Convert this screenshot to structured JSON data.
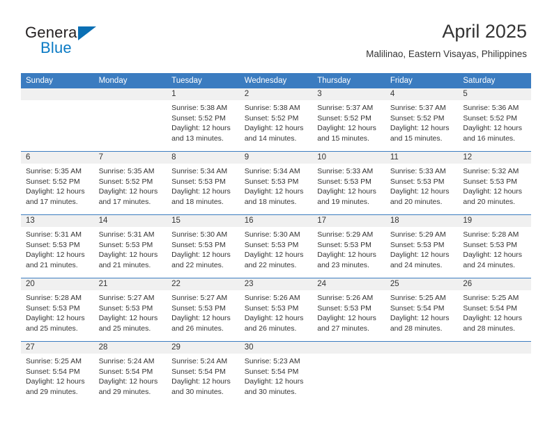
{
  "brand": {
    "name_part1": "General",
    "name_part2": "Blue",
    "triangle_color": "#0a6fb4",
    "blue_color": "#0a7ac4"
  },
  "header": {
    "title": "April 2025",
    "subtitle": "Malilinao, Eastern Visayas, Philippines"
  },
  "theme": {
    "header_bg": "#3b7cc0",
    "daynum_bg": "#f0f0f0",
    "text": "#333333"
  },
  "weekday_headers": [
    "Sunday",
    "Monday",
    "Tuesday",
    "Wednesday",
    "Thursday",
    "Friday",
    "Saturday"
  ],
  "labels": {
    "sunrise_prefix": "Sunrise:",
    "sunset_prefix": "Sunset:",
    "daylight_prefix": "Daylight:"
  },
  "weeks": [
    [
      {
        "day": "",
        "sunrise": "",
        "sunset": "",
        "daylight_line1": "",
        "daylight_line2": "",
        "blank": true
      },
      {
        "day": "",
        "sunrise": "",
        "sunset": "",
        "daylight_line1": "",
        "daylight_line2": "",
        "blank": true
      },
      {
        "day": "1",
        "sunrise": "Sunrise: 5:38 AM",
        "sunset": "Sunset: 5:52 PM",
        "daylight_line1": "Daylight: 12 hours",
        "daylight_line2": "and 13 minutes."
      },
      {
        "day": "2",
        "sunrise": "Sunrise: 5:38 AM",
        "sunset": "Sunset: 5:52 PM",
        "daylight_line1": "Daylight: 12 hours",
        "daylight_line2": "and 14 minutes."
      },
      {
        "day": "3",
        "sunrise": "Sunrise: 5:37 AM",
        "sunset": "Sunset: 5:52 PM",
        "daylight_line1": "Daylight: 12 hours",
        "daylight_line2": "and 15 minutes."
      },
      {
        "day": "4",
        "sunrise": "Sunrise: 5:37 AM",
        "sunset": "Sunset: 5:52 PM",
        "daylight_line1": "Daylight: 12 hours",
        "daylight_line2": "and 15 minutes."
      },
      {
        "day": "5",
        "sunrise": "Sunrise: 5:36 AM",
        "sunset": "Sunset: 5:52 PM",
        "daylight_line1": "Daylight: 12 hours",
        "daylight_line2": "and 16 minutes."
      }
    ],
    [
      {
        "day": "6",
        "sunrise": "Sunrise: 5:35 AM",
        "sunset": "Sunset: 5:52 PM",
        "daylight_line1": "Daylight: 12 hours",
        "daylight_line2": "and 17 minutes."
      },
      {
        "day": "7",
        "sunrise": "Sunrise: 5:35 AM",
        "sunset": "Sunset: 5:52 PM",
        "daylight_line1": "Daylight: 12 hours",
        "daylight_line2": "and 17 minutes."
      },
      {
        "day": "8",
        "sunrise": "Sunrise: 5:34 AM",
        "sunset": "Sunset: 5:53 PM",
        "daylight_line1": "Daylight: 12 hours",
        "daylight_line2": "and 18 minutes."
      },
      {
        "day": "9",
        "sunrise": "Sunrise: 5:34 AM",
        "sunset": "Sunset: 5:53 PM",
        "daylight_line1": "Daylight: 12 hours",
        "daylight_line2": "and 18 minutes."
      },
      {
        "day": "10",
        "sunrise": "Sunrise: 5:33 AM",
        "sunset": "Sunset: 5:53 PM",
        "daylight_line1": "Daylight: 12 hours",
        "daylight_line2": "and 19 minutes."
      },
      {
        "day": "11",
        "sunrise": "Sunrise: 5:33 AM",
        "sunset": "Sunset: 5:53 PM",
        "daylight_line1": "Daylight: 12 hours",
        "daylight_line2": "and 20 minutes."
      },
      {
        "day": "12",
        "sunrise": "Sunrise: 5:32 AM",
        "sunset": "Sunset: 5:53 PM",
        "daylight_line1": "Daylight: 12 hours",
        "daylight_line2": "and 20 minutes."
      }
    ],
    [
      {
        "day": "13",
        "sunrise": "Sunrise: 5:31 AM",
        "sunset": "Sunset: 5:53 PM",
        "daylight_line1": "Daylight: 12 hours",
        "daylight_line2": "and 21 minutes."
      },
      {
        "day": "14",
        "sunrise": "Sunrise: 5:31 AM",
        "sunset": "Sunset: 5:53 PM",
        "daylight_line1": "Daylight: 12 hours",
        "daylight_line2": "and 21 minutes."
      },
      {
        "day": "15",
        "sunrise": "Sunrise: 5:30 AM",
        "sunset": "Sunset: 5:53 PM",
        "daylight_line1": "Daylight: 12 hours",
        "daylight_line2": "and 22 minutes."
      },
      {
        "day": "16",
        "sunrise": "Sunrise: 5:30 AM",
        "sunset": "Sunset: 5:53 PM",
        "daylight_line1": "Daylight: 12 hours",
        "daylight_line2": "and 22 minutes."
      },
      {
        "day": "17",
        "sunrise": "Sunrise: 5:29 AM",
        "sunset": "Sunset: 5:53 PM",
        "daylight_line1": "Daylight: 12 hours",
        "daylight_line2": "and 23 minutes."
      },
      {
        "day": "18",
        "sunrise": "Sunrise: 5:29 AM",
        "sunset": "Sunset: 5:53 PM",
        "daylight_line1": "Daylight: 12 hours",
        "daylight_line2": "and 24 minutes."
      },
      {
        "day": "19",
        "sunrise": "Sunrise: 5:28 AM",
        "sunset": "Sunset: 5:53 PM",
        "daylight_line1": "Daylight: 12 hours",
        "daylight_line2": "and 24 minutes."
      }
    ],
    [
      {
        "day": "20",
        "sunrise": "Sunrise: 5:28 AM",
        "sunset": "Sunset: 5:53 PM",
        "daylight_line1": "Daylight: 12 hours",
        "daylight_line2": "and 25 minutes."
      },
      {
        "day": "21",
        "sunrise": "Sunrise: 5:27 AM",
        "sunset": "Sunset: 5:53 PM",
        "daylight_line1": "Daylight: 12 hours",
        "daylight_line2": "and 25 minutes."
      },
      {
        "day": "22",
        "sunrise": "Sunrise: 5:27 AM",
        "sunset": "Sunset: 5:53 PM",
        "daylight_line1": "Daylight: 12 hours",
        "daylight_line2": "and 26 minutes."
      },
      {
        "day": "23",
        "sunrise": "Sunrise: 5:26 AM",
        "sunset": "Sunset: 5:53 PM",
        "daylight_line1": "Daylight: 12 hours",
        "daylight_line2": "and 26 minutes."
      },
      {
        "day": "24",
        "sunrise": "Sunrise: 5:26 AM",
        "sunset": "Sunset: 5:53 PM",
        "daylight_line1": "Daylight: 12 hours",
        "daylight_line2": "and 27 minutes."
      },
      {
        "day": "25",
        "sunrise": "Sunrise: 5:25 AM",
        "sunset": "Sunset: 5:54 PM",
        "daylight_line1": "Daylight: 12 hours",
        "daylight_line2": "and 28 minutes."
      },
      {
        "day": "26",
        "sunrise": "Sunrise: 5:25 AM",
        "sunset": "Sunset: 5:54 PM",
        "daylight_line1": "Daylight: 12 hours",
        "daylight_line2": "and 28 minutes."
      }
    ],
    [
      {
        "day": "27",
        "sunrise": "Sunrise: 5:25 AM",
        "sunset": "Sunset: 5:54 PM",
        "daylight_line1": "Daylight: 12 hours",
        "daylight_line2": "and 29 minutes."
      },
      {
        "day": "28",
        "sunrise": "Sunrise: 5:24 AM",
        "sunset": "Sunset: 5:54 PM",
        "daylight_line1": "Daylight: 12 hours",
        "daylight_line2": "and 29 minutes."
      },
      {
        "day": "29",
        "sunrise": "Sunrise: 5:24 AM",
        "sunset": "Sunset: 5:54 PM",
        "daylight_line1": "Daylight: 12 hours",
        "daylight_line2": "and 30 minutes."
      },
      {
        "day": "30",
        "sunrise": "Sunrise: 5:23 AM",
        "sunset": "Sunset: 5:54 PM",
        "daylight_line1": "Daylight: 12 hours",
        "daylight_line2": "and 30 minutes."
      },
      {
        "day": "",
        "sunrise": "",
        "sunset": "",
        "daylight_line1": "",
        "daylight_line2": "",
        "blank": true
      },
      {
        "day": "",
        "sunrise": "",
        "sunset": "",
        "daylight_line1": "",
        "daylight_line2": "",
        "blank": true
      },
      {
        "day": "",
        "sunrise": "",
        "sunset": "",
        "daylight_line1": "",
        "daylight_line2": "",
        "blank": true
      }
    ]
  ]
}
